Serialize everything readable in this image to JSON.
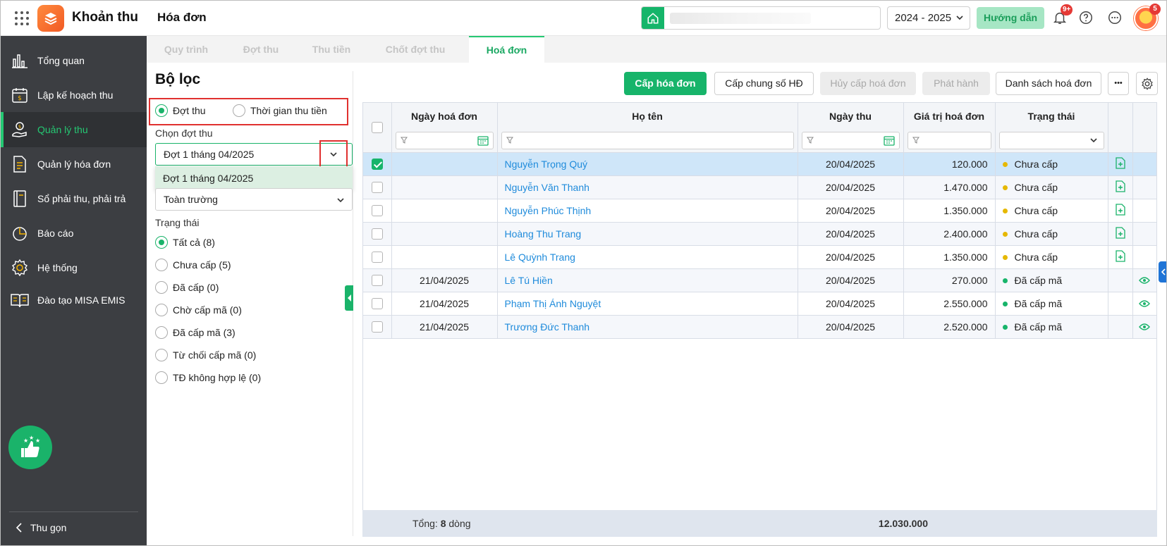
{
  "header": {
    "app_title": "Khoản thu",
    "page_title": "Hóa đơn",
    "year": "2024 - 2025",
    "guide_label": "Hướng dẫn",
    "notification_badge": "9+",
    "avatar_badge": "5"
  },
  "sidebar": {
    "items": [
      {
        "label": "Tổng quan",
        "icon": "chart-bars-icon"
      },
      {
        "label": "Lập kế hoạch thu",
        "icon": "calendar-money-icon"
      },
      {
        "label": "Quản lý thu",
        "icon": "hand-coin-icon"
      },
      {
        "label": "Quản lý hóa đơn",
        "icon": "document-icon"
      },
      {
        "label": "Sổ phải thu, phải trả",
        "icon": "ledger-book-icon"
      },
      {
        "label": "Báo cáo",
        "icon": "pie-chart-icon"
      },
      {
        "label": "Hệ thống",
        "icon": "gear-icon"
      },
      {
        "label": "Đào tạo MISA EMIS",
        "icon": "open-book-icon"
      }
    ],
    "collapse_label": "Thu gọn"
  },
  "tabs": [
    {
      "label": "Quy trình"
    },
    {
      "label": "Đợt thu"
    },
    {
      "label": "Thu tiền"
    },
    {
      "label": "Chốt đợt thu"
    },
    {
      "label": "Hoá đơn"
    }
  ],
  "filter": {
    "title": "Bộ lọc",
    "mode_options": [
      "Đợt thu",
      "Thời gian thu tiền"
    ],
    "batch_label": "Chọn đợt thu",
    "batch_value": "Đợt 1 tháng 04/2025",
    "batch_dropdown_option": "Đợt 1 tháng 04/2025",
    "scope_value": "Toàn trường",
    "status_label": "Trạng thái",
    "status_options": [
      "Tất cả (8)",
      "Chưa cấp (5)",
      "Đã cấp (0)",
      "Chờ cấp mã (0)",
      "Đã cấp mã (3)",
      "Từ chối cấp mã (0)",
      "TĐ không hợp lệ (0)"
    ]
  },
  "toolbar": {
    "issue_invoice": "Cấp hóa đơn",
    "shared_number": "Cấp chung số HĐ",
    "cancel_issue": "Hủy cấp hoá đơn",
    "publish": "Phát hành",
    "invoice_list": "Danh sách hoá đơn",
    "more": "•••"
  },
  "table": {
    "columns": [
      "Ngày hoá đơn",
      "Họ tên",
      "Ngày thu",
      "Giá trị hoá đơn",
      "Trạng thái"
    ],
    "rows": [
      {
        "invoice_date": "",
        "name": "Nguyễn Trọng Quý",
        "pay_date": "20/04/2025",
        "amount": "120.000",
        "status": "Chưa cấp",
        "status_color": "#e6b800",
        "action": "add-doc",
        "checked": true
      },
      {
        "invoice_date": "",
        "name": "Nguyễn Văn Thanh",
        "pay_date": "20/04/2025",
        "amount": "1.470.000",
        "status": "Chưa cấp",
        "status_color": "#e6b800",
        "action": "add-doc",
        "checked": false
      },
      {
        "invoice_date": "",
        "name": "Nguyễn Phúc Thịnh",
        "pay_date": "20/04/2025",
        "amount": "1.350.000",
        "status": "Chưa cấp",
        "status_color": "#e6b800",
        "action": "add-doc",
        "checked": false
      },
      {
        "invoice_date": "",
        "name": "Hoàng Thu Trang",
        "pay_date": "20/04/2025",
        "amount": "2.400.000",
        "status": "Chưa cấp",
        "status_color": "#e6b800",
        "action": "add-doc",
        "checked": false
      },
      {
        "invoice_date": "",
        "name": "Lê Quỳnh Trang",
        "pay_date": "20/04/2025",
        "amount": "1.350.000",
        "status": "Chưa cấp",
        "status_color": "#e6b800",
        "action": "add-doc",
        "checked": false
      },
      {
        "invoice_date": "21/04/2025",
        "name": "Lê Tú Hiền",
        "pay_date": "20/04/2025",
        "amount": "270.000",
        "status": "Đã cấp mã",
        "status_color": "#17b46a",
        "action": "view",
        "checked": false
      },
      {
        "invoice_date": "21/04/2025",
        "name": "Phạm Thị Ánh Nguyệt",
        "pay_date": "20/04/2025",
        "amount": "2.550.000",
        "status": "Đã cấp mã",
        "status_color": "#17b46a",
        "action": "view",
        "checked": false
      },
      {
        "invoice_date": "21/04/2025",
        "name": "Trương Đức Thanh",
        "pay_date": "20/04/2025",
        "amount": "2.520.000",
        "status": "Đã cấp mã",
        "status_color": "#17b46a",
        "action": "view",
        "checked": false
      }
    ],
    "footer_prefix": "Tổng: ",
    "footer_count": "8",
    "footer_suffix": " dòng",
    "footer_total": "12.030.000"
  }
}
